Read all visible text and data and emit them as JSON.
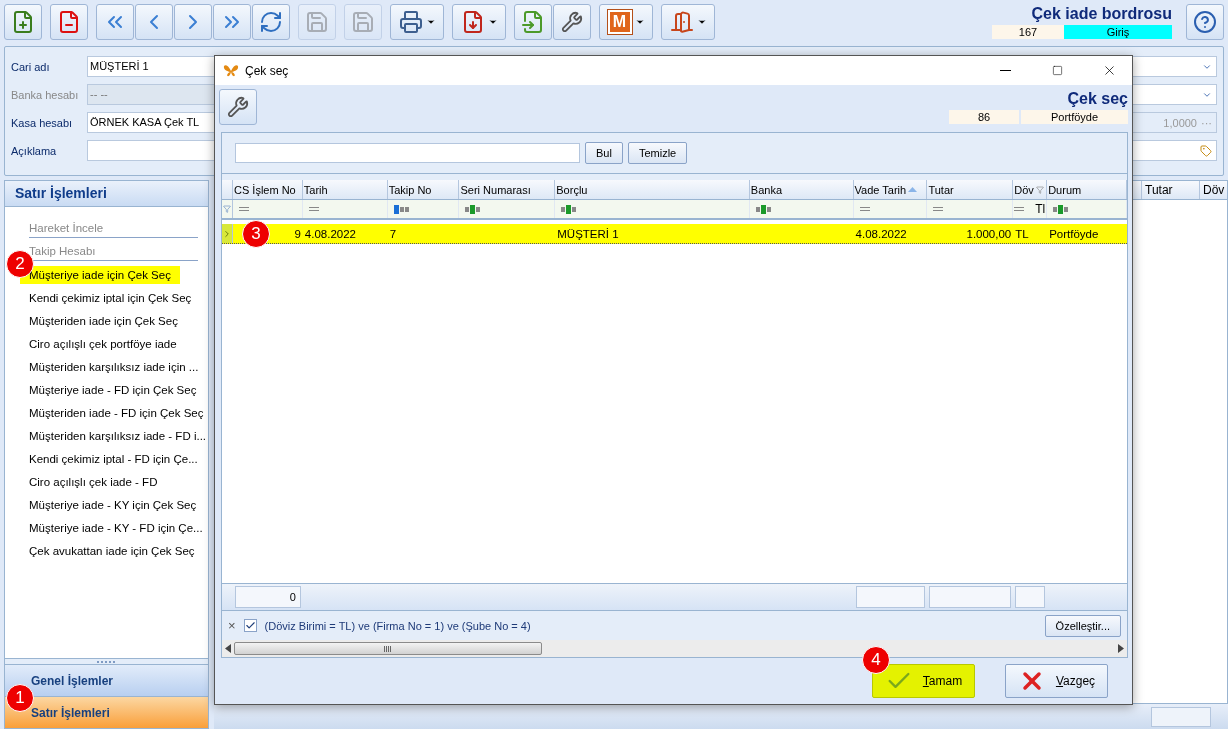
{
  "toolbar": [
    {
      "buttons": [
        {
          "kind": "new",
          "disabled": false
        }
      ]
    },
    {
      "buttons": [
        {
          "kind": "delete",
          "disabled": false
        }
      ]
    },
    {
      "buttons": [
        {
          "kind": "first",
          "disabled": false
        },
        {
          "kind": "prev",
          "disabled": false
        },
        {
          "kind": "next",
          "disabled": false
        },
        {
          "kind": "last",
          "disabled": false
        },
        {
          "kind": "refresh",
          "disabled": false
        }
      ]
    },
    {
      "buttons": [
        {
          "kind": "save",
          "disabled": true
        }
      ]
    },
    {
      "buttons": [
        {
          "kind": "save-cancel",
          "disabled": true
        }
      ]
    },
    {
      "buttons": [
        {
          "kind": "print",
          "disabled": false,
          "dropdown": true
        }
      ]
    },
    {
      "buttons": [
        {
          "kind": "pdf",
          "disabled": false,
          "dropdown": true
        }
      ]
    },
    {
      "buttons": [
        {
          "kind": "import",
          "disabled": false
        },
        {
          "kind": "tools",
          "disabled": false
        }
      ]
    },
    {
      "buttons": [
        {
          "kind": "letter",
          "label": "M",
          "disabled": false,
          "dropdown": true
        }
      ]
    },
    {
      "buttons": [
        {
          "kind": "exit",
          "disabled": false,
          "dropdown": true
        }
      ]
    }
  ],
  "header": {
    "title": "Çek iade bordrosu",
    "number": "167",
    "status": "Giriş"
  },
  "form": {
    "fields": [
      {
        "label": "Cari adı",
        "value": "MÜŞTERİ 1",
        "disabled": false,
        "side": {
          "kind": "dropdown"
        }
      },
      {
        "label": "Banka hesabı",
        "value": "-- --",
        "disabled": true,
        "side": {
          "kind": "dropdown"
        }
      },
      {
        "label": "Kasa hesabı",
        "value": "ÖRNEK KASA Çek TL",
        "disabled": false,
        "side": {
          "kind": "number",
          "value": "1,0000",
          "button": "···"
        }
      },
      {
        "label": "Açıklama",
        "disabled": false,
        "side": {
          "kind": "tag"
        }
      }
    ]
  },
  "sidebar": {
    "title": "Satır İşlemleri",
    "items": [
      {
        "label": "Hareket İncele",
        "disabled": true,
        "selected": false
      },
      {
        "label": "Takip Hesabı",
        "disabled": true,
        "selected": false
      },
      {
        "label": "Müşteriye iade için Çek Seç",
        "disabled": false,
        "selected": true,
        "callout": "2"
      },
      {
        "label": "Kendi çekimiz iptal için Çek Seç",
        "disabled": false,
        "selected": false
      },
      {
        "label": "Müşteriden iade için Çek Seç",
        "disabled": false,
        "selected": false
      },
      {
        "label": "Ciro açılışlı çek portföye iade",
        "disabled": false,
        "selected": false
      },
      {
        "label": "Müşteriden karşılıksız iade için ...",
        "disabled": false,
        "selected": false
      },
      {
        "label": "Müşteriye iade - FD için Çek Seç",
        "disabled": false,
        "selected": false
      },
      {
        "label": "Müşteriden iade - FD için Çek Seç",
        "disabled": false,
        "selected": false
      },
      {
        "label": "Müşteriden karşılıksız iade - FD i...",
        "disabled": false,
        "selected": false
      },
      {
        "label": "Kendi çekimiz iptal - FD için Çe...",
        "disabled": false,
        "selected": false
      },
      {
        "label": "Ciro açılışlı çek iade - FD",
        "disabled": false,
        "selected": false
      },
      {
        "label": "Müşteriye iade - KY için Çek Seç",
        "disabled": false,
        "selected": false
      },
      {
        "label": "Müşteriye iade - KY - FD için Çe...",
        "disabled": false,
        "selected": false
      },
      {
        "label": "Çek avukattan iade için Çek Seç",
        "disabled": false,
        "selected": false
      }
    ],
    "groups": [
      {
        "label": "Genel İşlemler",
        "selected": false
      },
      {
        "label": "Satır İşlemleri",
        "selected": true,
        "callout": "1"
      }
    ]
  },
  "background_grid": {
    "columns": [
      "Tutar",
      "Döv"
    ]
  },
  "dialog": {
    "title": "Çek seç",
    "heading": "Çek seç",
    "number": "86",
    "status": "Portföyde",
    "search": {
      "buttons": [
        "Bul",
        "Temizle"
      ]
    },
    "grid": {
      "columns": [
        {
          "label": "CS İşlem No",
          "filter": {
            "kind": "equals"
          }
        },
        {
          "label": "Tarih",
          "filter": {
            "kind": "equals"
          }
        },
        {
          "label": "Takip No",
          "filter": {
            "kind": "starts"
          }
        },
        {
          "label": "Seri Numarası",
          "filter": {
            "kind": "contains"
          }
        },
        {
          "label": "Borçlu",
          "filter": {
            "kind": "contains"
          }
        },
        {
          "label": "Banka",
          "filter": {
            "kind": "contains"
          }
        },
        {
          "label": "Vade Tarih",
          "filter": {
            "kind": "equals"
          },
          "sorted": true
        },
        {
          "label": "Tutar",
          "filter": {
            "kind": "equals"
          }
        },
        {
          "label": "Döv",
          "filter": {
            "kind": "equals",
            "value": "Tl"
          },
          "filtered": true
        },
        {
          "label": "Durum",
          "filter": {
            "kind": "contains"
          }
        }
      ],
      "rows": [
        {
          "selected": true,
          "callout": "3",
          "cells": [
            "9",
            "4.08.2022",
            "7",
            null,
            "MÜŞTERİ 1",
            null,
            "4.08.2022",
            "1.000,00",
            "TL",
            "Portföyde"
          ]
        }
      ],
      "summary": [
        {
          "kind": "sum",
          "value": "0"
        },
        {
          "kind": "none"
        },
        {
          "kind": "none"
        },
        {
          "kind": "none"
        },
        {
          "kind": "none"
        },
        {
          "kind": "none"
        },
        {
          "kind": "blank"
        },
        {
          "kind": "blank"
        },
        {
          "kind": "blank"
        },
        {
          "kind": "none"
        }
      ]
    },
    "filter_bar": {
      "close": "×",
      "enabled": true,
      "text": "(Döviz Birimi = TL) ve (Firma No = 1) ve (Şube No = 4)",
      "button": "Özelleştir..."
    },
    "buttons": [
      {
        "kind": "ok",
        "label": "Tamam",
        "highlighted": true,
        "callout": "4"
      },
      {
        "kind": "cancel",
        "label": "Vazgeç",
        "highlighted": false
      }
    ]
  }
}
